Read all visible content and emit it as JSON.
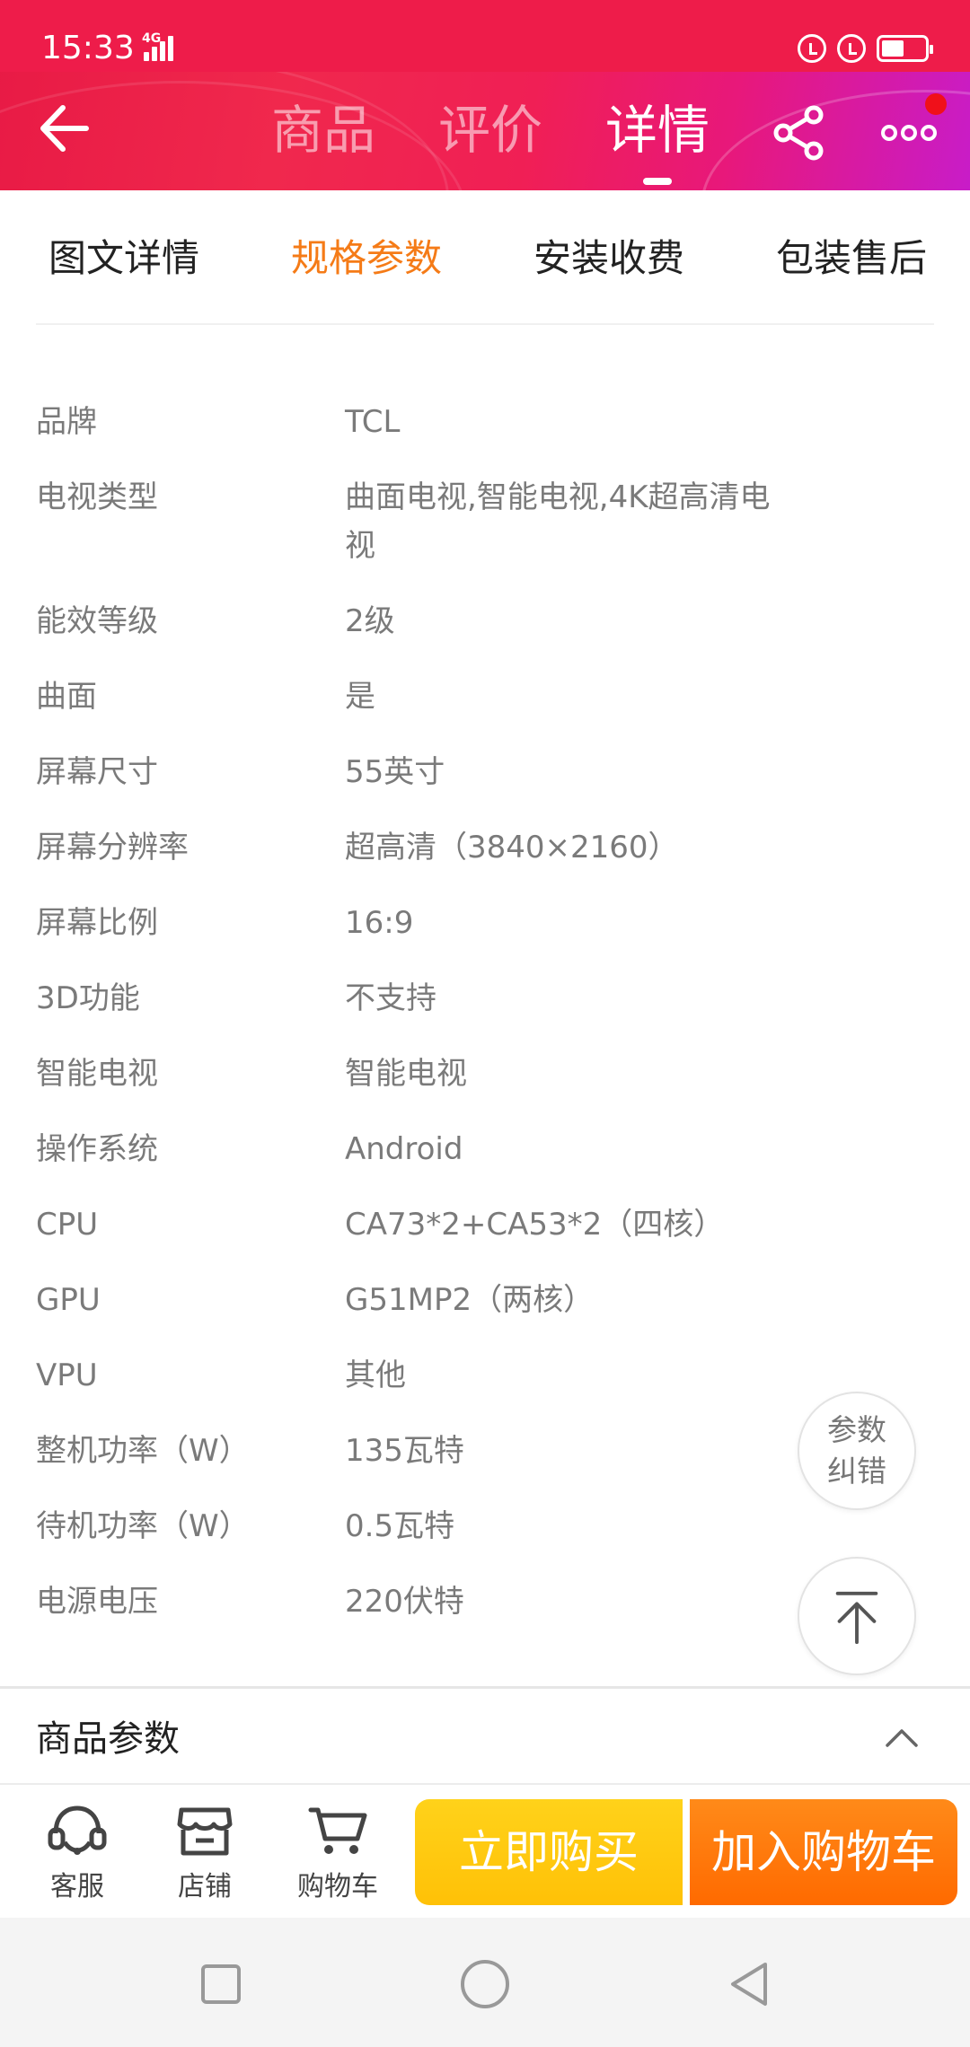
{
  "status_bar": {
    "time": "15:33",
    "network": "4G"
  },
  "nav": {
    "tabs": [
      "商品",
      "评价",
      "详情"
    ],
    "active_tab": "详情"
  },
  "sub_tabs": {
    "items": [
      "图文详情",
      "规格参数",
      "安装收费",
      "包装售后"
    ],
    "active": "规格参数"
  },
  "specs": [
    {
      "label": "品牌",
      "value": "TCL"
    },
    {
      "label": "电视类型",
      "value_line1": "曲面电视,智能电视,4K超高清电",
      "value_line2": "视"
    },
    {
      "label": "能效等级",
      "value": "2级"
    },
    {
      "label": "曲面",
      "value": "是"
    },
    {
      "label": "屏幕尺寸",
      "value": "55英寸"
    },
    {
      "label": "屏幕分辨率",
      "value": "超高清（3840×2160）"
    },
    {
      "label": "屏幕比例",
      "value": "16:9"
    },
    {
      "label": "3D功能",
      "value": "不支持"
    },
    {
      "label": "智能电视",
      "value": "智能电视"
    },
    {
      "label": "操作系统",
      "value": "Android"
    },
    {
      "label": "CPU",
      "value": "CA73*2+CA53*2（四核）"
    },
    {
      "label": "GPU",
      "value": "G51MP2（两核）"
    },
    {
      "label": "VPU",
      "value": "其他"
    },
    {
      "label": "整机功率（W）",
      "value": "135瓦特"
    },
    {
      "label": "待机功率（W）",
      "value": "0.5瓦特"
    },
    {
      "label": "电源电压",
      "value": "220伏特"
    }
  ],
  "float_buttons": {
    "error_line1": "参数",
    "error_line2": "纠错"
  },
  "section": {
    "title": "商品参数"
  },
  "action_bar": {
    "service": "客服",
    "shop": "店铺",
    "cart": "购物车",
    "buy_now": "立即购买",
    "add_to_cart": "加入购物车"
  },
  "colors": {
    "header_red": "#ee1c4a",
    "header_purple": "#c81cc8",
    "active_orange": "#f57b17",
    "buy_yellow": "#ffc107",
    "cart_orange": "#ff6a00"
  }
}
